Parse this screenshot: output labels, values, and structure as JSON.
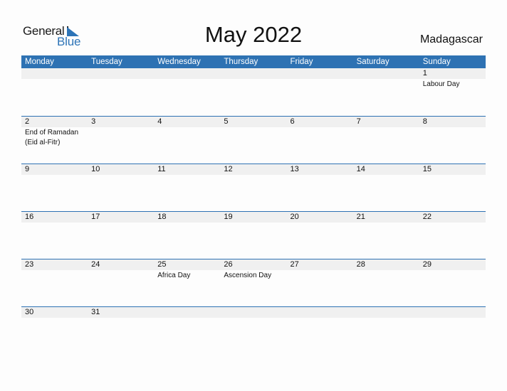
{
  "logo": {
    "word1": "General",
    "word2": "Blue"
  },
  "title": "May 2022",
  "country": "Madagascar",
  "colors": {
    "accent": "#2e72b3",
    "strip": "#f0f0f0"
  },
  "weekdays": [
    "Monday",
    "Tuesday",
    "Wednesday",
    "Thursday",
    "Friday",
    "Saturday",
    "Sunday"
  ],
  "weeks": [
    [
      {
        "day": "",
        "event": ""
      },
      {
        "day": "",
        "event": ""
      },
      {
        "day": "",
        "event": ""
      },
      {
        "day": "",
        "event": ""
      },
      {
        "day": "",
        "event": ""
      },
      {
        "day": "",
        "event": ""
      },
      {
        "day": "1",
        "event": "Labour Day"
      }
    ],
    [
      {
        "day": "2",
        "event": "End of Ramadan (Eid al-Fitr)"
      },
      {
        "day": "3",
        "event": ""
      },
      {
        "day": "4",
        "event": ""
      },
      {
        "day": "5",
        "event": ""
      },
      {
        "day": "6",
        "event": ""
      },
      {
        "day": "7",
        "event": ""
      },
      {
        "day": "8",
        "event": ""
      }
    ],
    [
      {
        "day": "9",
        "event": ""
      },
      {
        "day": "10",
        "event": ""
      },
      {
        "day": "11",
        "event": ""
      },
      {
        "day": "12",
        "event": ""
      },
      {
        "day": "13",
        "event": ""
      },
      {
        "day": "14",
        "event": ""
      },
      {
        "day": "15",
        "event": ""
      }
    ],
    [
      {
        "day": "16",
        "event": ""
      },
      {
        "day": "17",
        "event": ""
      },
      {
        "day": "18",
        "event": ""
      },
      {
        "day": "19",
        "event": ""
      },
      {
        "day": "20",
        "event": ""
      },
      {
        "day": "21",
        "event": ""
      },
      {
        "day": "22",
        "event": ""
      }
    ],
    [
      {
        "day": "23",
        "event": ""
      },
      {
        "day": "24",
        "event": ""
      },
      {
        "day": "25",
        "event": "Africa Day"
      },
      {
        "day": "26",
        "event": "Ascension Day"
      },
      {
        "day": "27",
        "event": ""
      },
      {
        "day": "28",
        "event": ""
      },
      {
        "day": "29",
        "event": ""
      }
    ],
    [
      {
        "day": "30",
        "event": ""
      },
      {
        "day": "31",
        "event": ""
      },
      {
        "day": "",
        "event": ""
      },
      {
        "day": "",
        "event": ""
      },
      {
        "day": "",
        "event": ""
      },
      {
        "day": "",
        "event": ""
      },
      {
        "day": "",
        "event": ""
      }
    ]
  ]
}
